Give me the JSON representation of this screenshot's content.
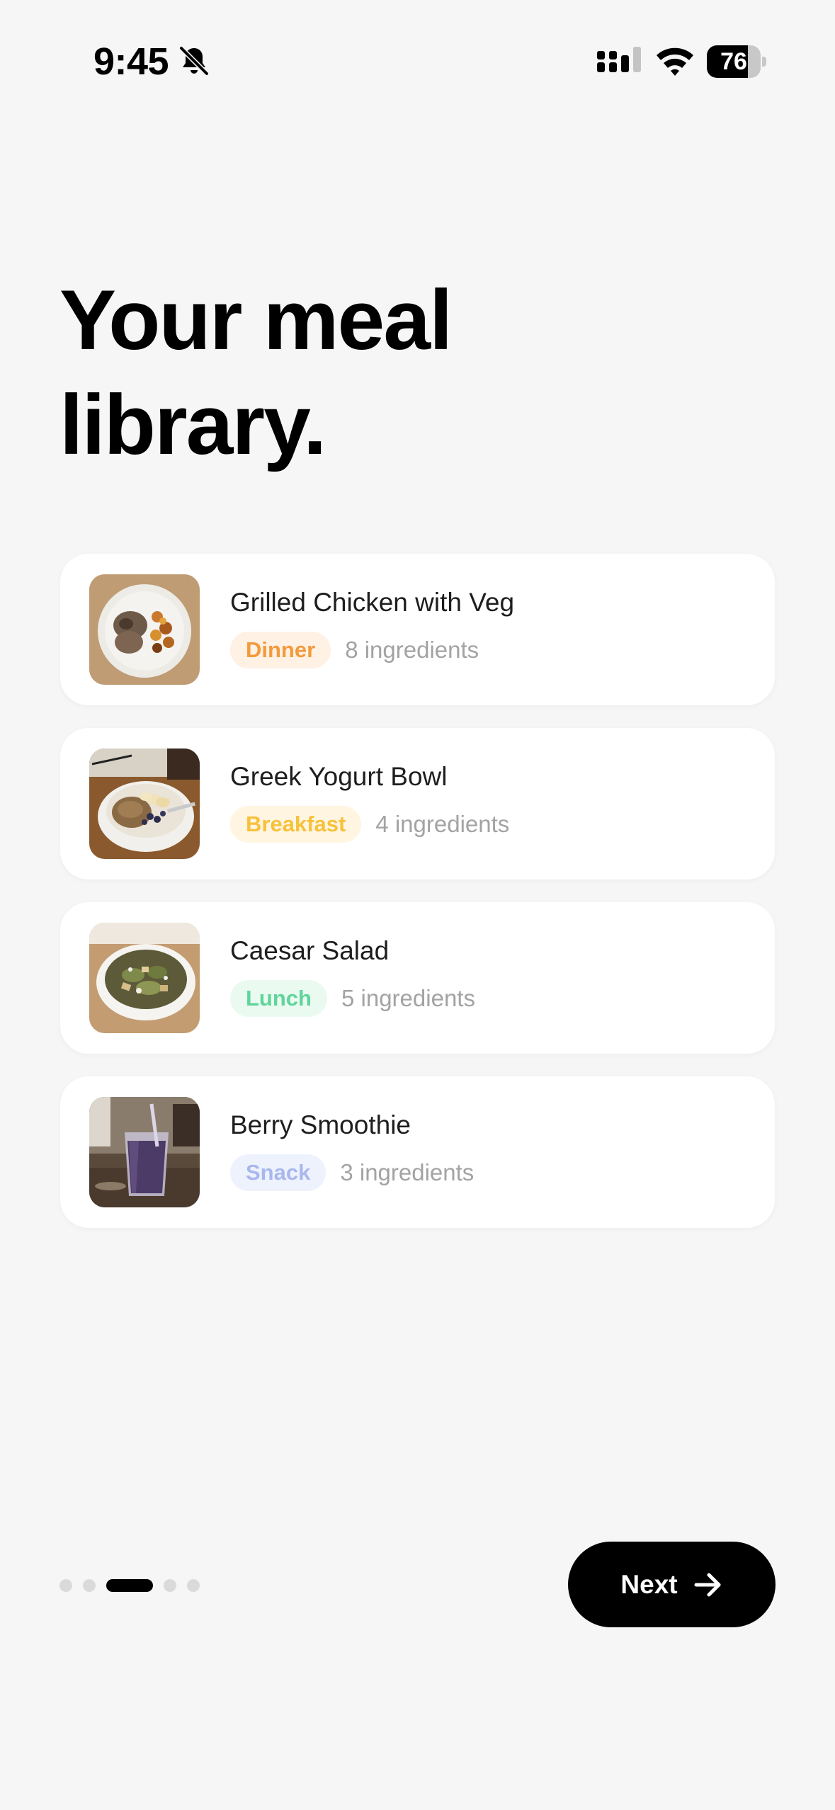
{
  "status_bar": {
    "time": "9:45",
    "battery_percent": 76
  },
  "onboarding": {
    "title_line1": "Your meal",
    "title_line2": "library.",
    "current_step": 3,
    "total_steps": 5,
    "next_label": "Next"
  },
  "meals": [
    {
      "name": "Grilled Chicken with Veg",
      "category": "Dinner",
      "ingredients": "8 ingredients",
      "badge_color": "#f39a3c",
      "badge_bg": "#fff1e3",
      "thumbnail": "grilled-chicken-plate"
    },
    {
      "name": "Greek Yogurt Bowl",
      "category": "Breakfast",
      "ingredients": "4 ingredients",
      "badge_color": "#f7c13c",
      "badge_bg": "#fff5e1",
      "thumbnail": "yogurt-granola-bowl"
    },
    {
      "name": "Caesar Salad",
      "category": "Lunch",
      "ingredients": "5 ingredients",
      "badge_color": "#5fd59a",
      "badge_bg": "#eafaf1",
      "thumbnail": "caesar-salad-bowl"
    },
    {
      "name": "Berry Smoothie",
      "category": "Snack",
      "ingredients": "3 ingredients",
      "badge_color": "#a8b8ee",
      "badge_bg": "#eef2fd",
      "thumbnail": "berry-smoothie-glass"
    }
  ],
  "theme": {
    "background": "#f6f6f6",
    "card": "#ffffff",
    "primary": "#000000"
  }
}
